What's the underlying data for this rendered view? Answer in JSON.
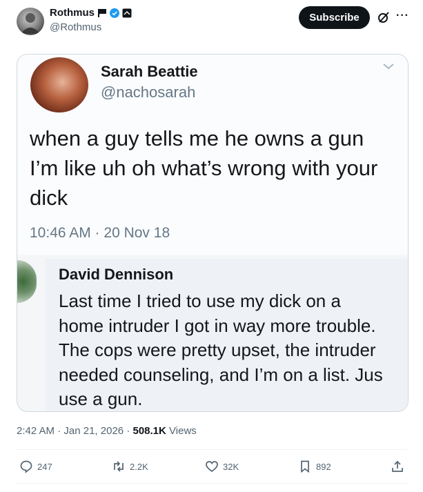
{
  "header": {
    "author_name": "Rothmus",
    "author_handle": "@Rothmus",
    "subscribe_label": "Subscribe",
    "more_label": "···"
  },
  "embedded": {
    "original": {
      "name": "Sarah Beattie",
      "handle": "@nachosarah",
      "text": "when a guy tells me he owns a gun I’m like uh oh what’s wrong with your dick",
      "timestamp": "10:46 AM · 20 Nov 18"
    },
    "reply": {
      "name": "David Dennison",
      "lines": [
        "Last time I tried to use my dick on a",
        "home intruder I got in way more trouble.",
        "The cops were pretty upset, the intruder",
        "needed counseling, and I’m on a list. Jus",
        "use a gun."
      ]
    }
  },
  "meta": {
    "time": "2:42 AM",
    "date": "Jan 21, 2026",
    "views_count": "508.1K",
    "views_label": "Views"
  },
  "actions": {
    "replies": "247",
    "reposts": "2.2K",
    "likes": "32K",
    "bookmarks": "892"
  },
  "icons": [
    "flag-icon",
    "verified-badge-icon",
    "affiliate-badge-icon",
    "grok-icon",
    "more-icon",
    "chevron-down-icon",
    "reply-icon",
    "repost-icon",
    "like-icon",
    "bookmark-icon",
    "share-icon"
  ],
  "colors": {
    "verified": "#1d9bf0",
    "subscribe_bg": "#0f1419",
    "muted": "#536471"
  }
}
